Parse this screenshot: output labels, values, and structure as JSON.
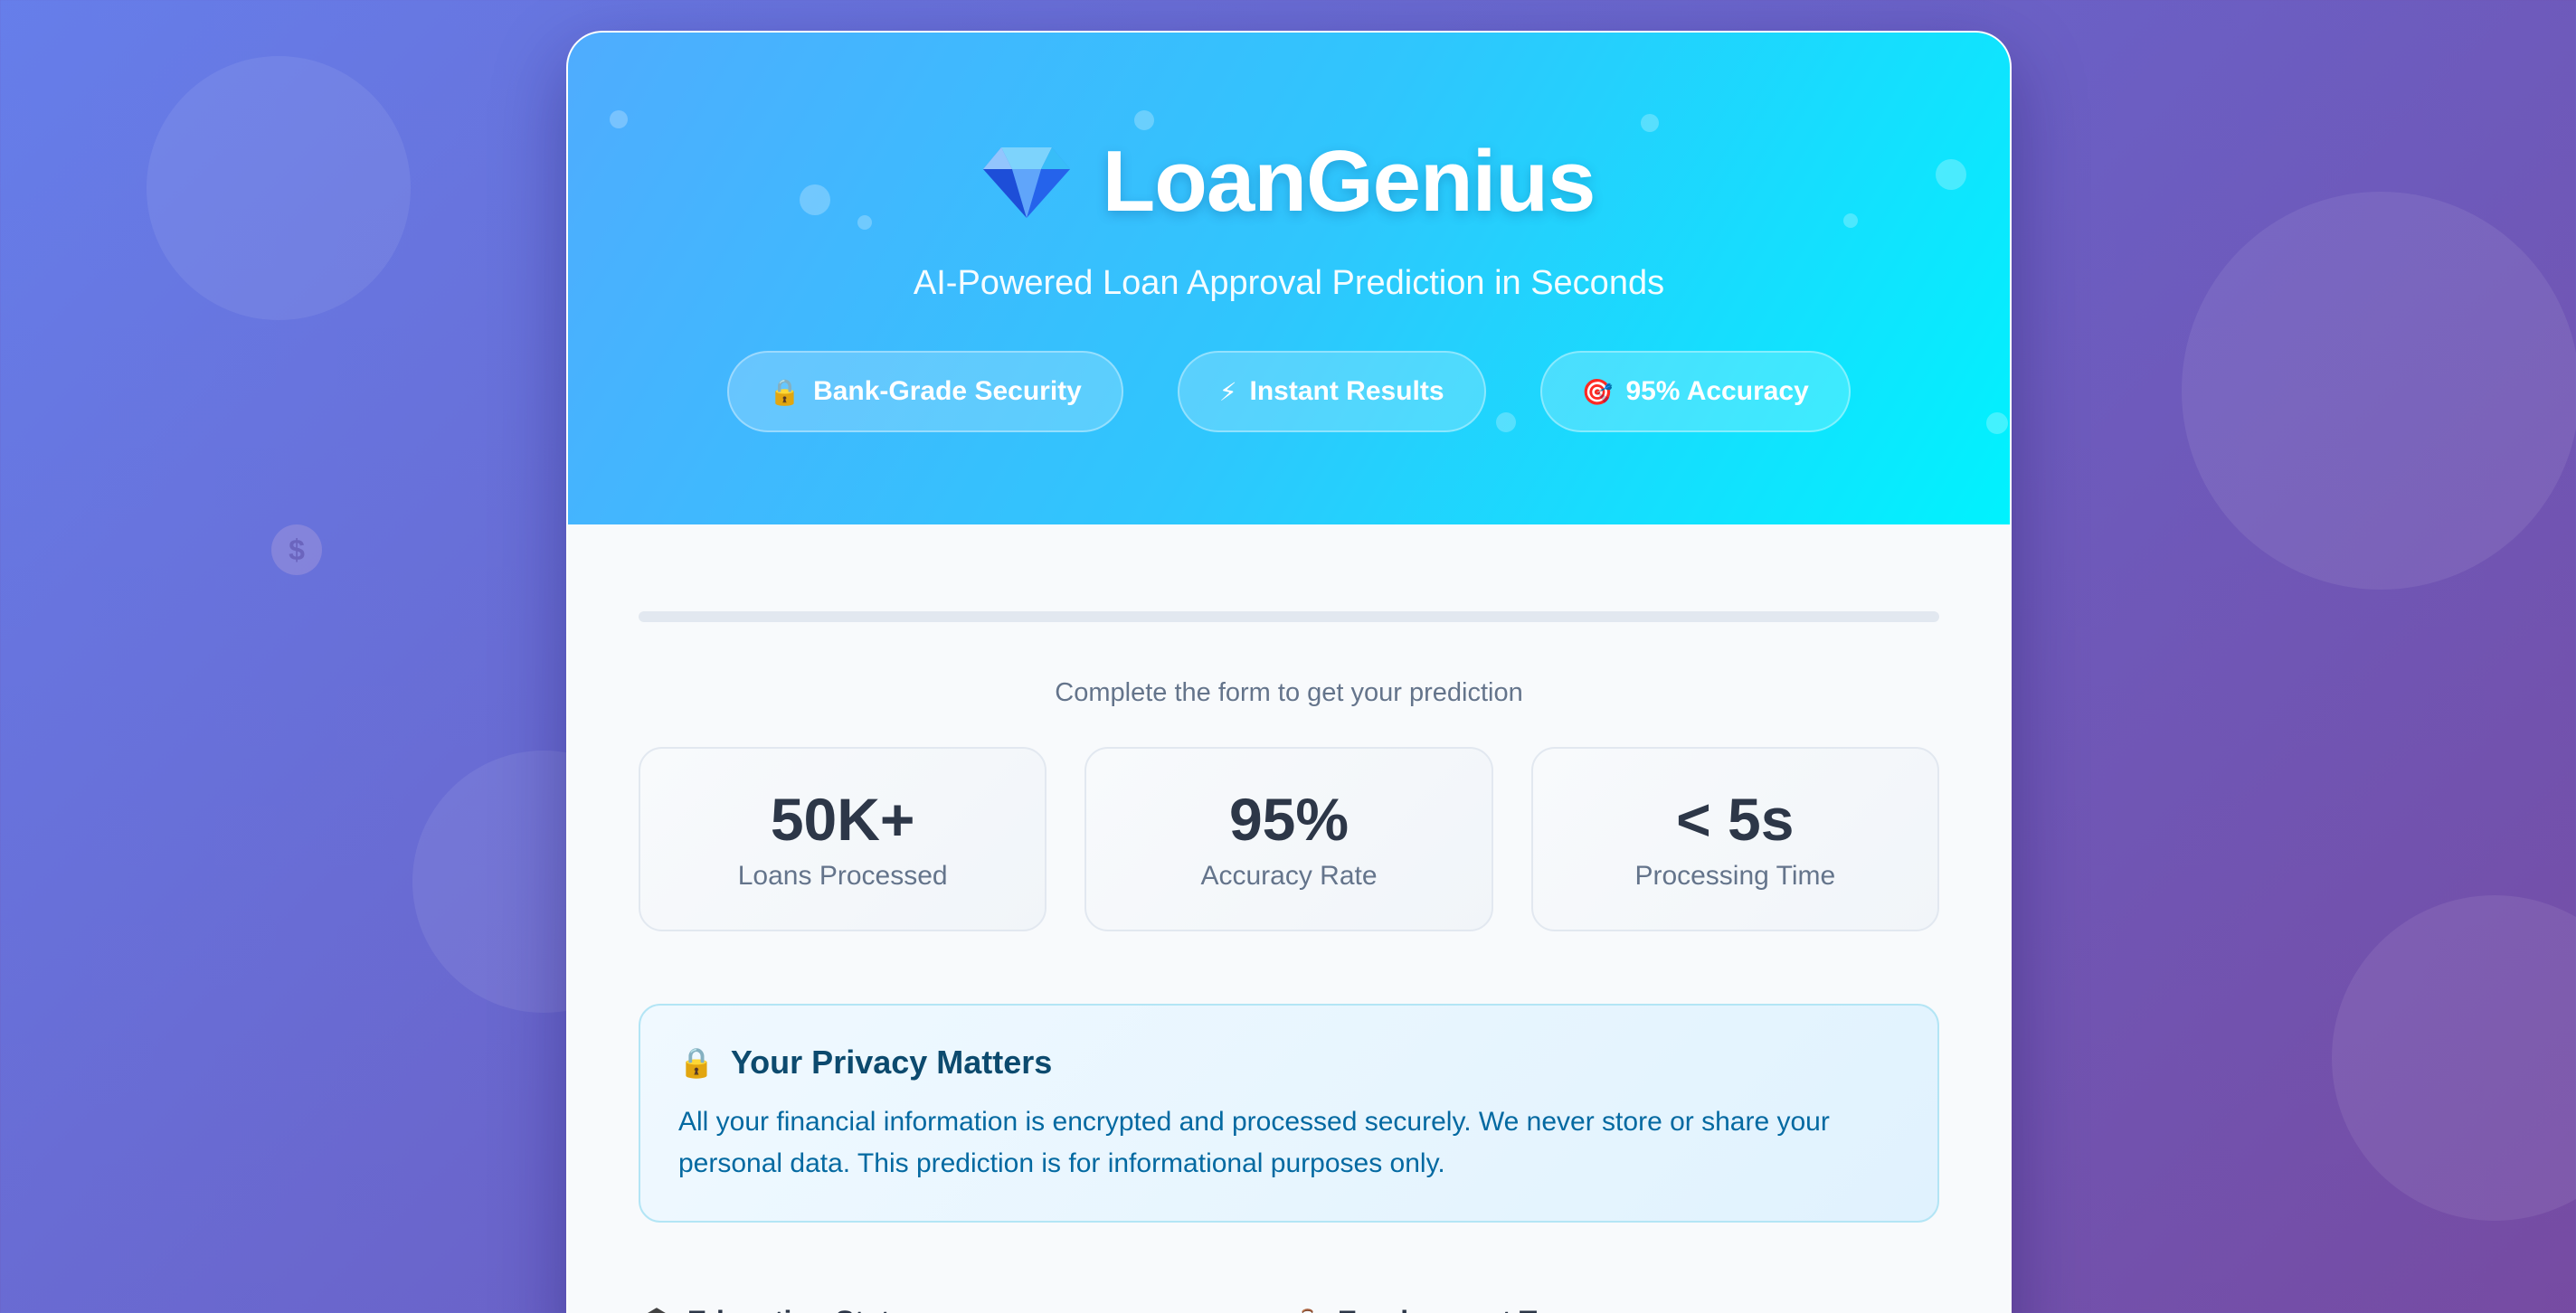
{
  "app": {
    "title": "LoanGenius",
    "subtitle": "AI-Powered Loan Approval Prediction in Seconds",
    "logo_icon": "gem-icon"
  },
  "badges": [
    {
      "icon": "lock-icon",
      "glyph": "🔒",
      "label": "Bank-Grade Security"
    },
    {
      "icon": "lightning-icon",
      "glyph": "⚡",
      "label": "Instant Results"
    },
    {
      "icon": "target-icon",
      "glyph": "🎯",
      "label": "95% Accuracy"
    }
  ],
  "progress": {
    "fraction": 0,
    "text": "Complete the form to get your prediction"
  },
  "stats": [
    {
      "value": "50K+",
      "label": "Loans Processed"
    },
    {
      "value": "95%",
      "label": "Accuracy Rate"
    },
    {
      "value": "< 5s",
      "label": "Processing Time"
    }
  ],
  "privacy": {
    "icon": "lock-icon",
    "glyph": "🔒",
    "title": "Your Privacy Matters",
    "text": "All your financial information is encrypted and processed securely. We never store or share your personal data. This prediction is for informational purposes only."
  },
  "form": {
    "fields": [
      {
        "icon": "graduation-cap-icon",
        "glyph": "🎓",
        "label": "Education Status"
      },
      {
        "icon": "briefcase-icon",
        "glyph": "💼",
        "label": "Employment Type"
      }
    ]
  },
  "colors": {
    "bg_start": "#667eea",
    "bg_end": "#764ba2",
    "hero_start": "#4facfe",
    "hero_end": "#00f2fe"
  },
  "background_icon": {
    "icon": "money-bag-icon",
    "glyph": "$"
  }
}
